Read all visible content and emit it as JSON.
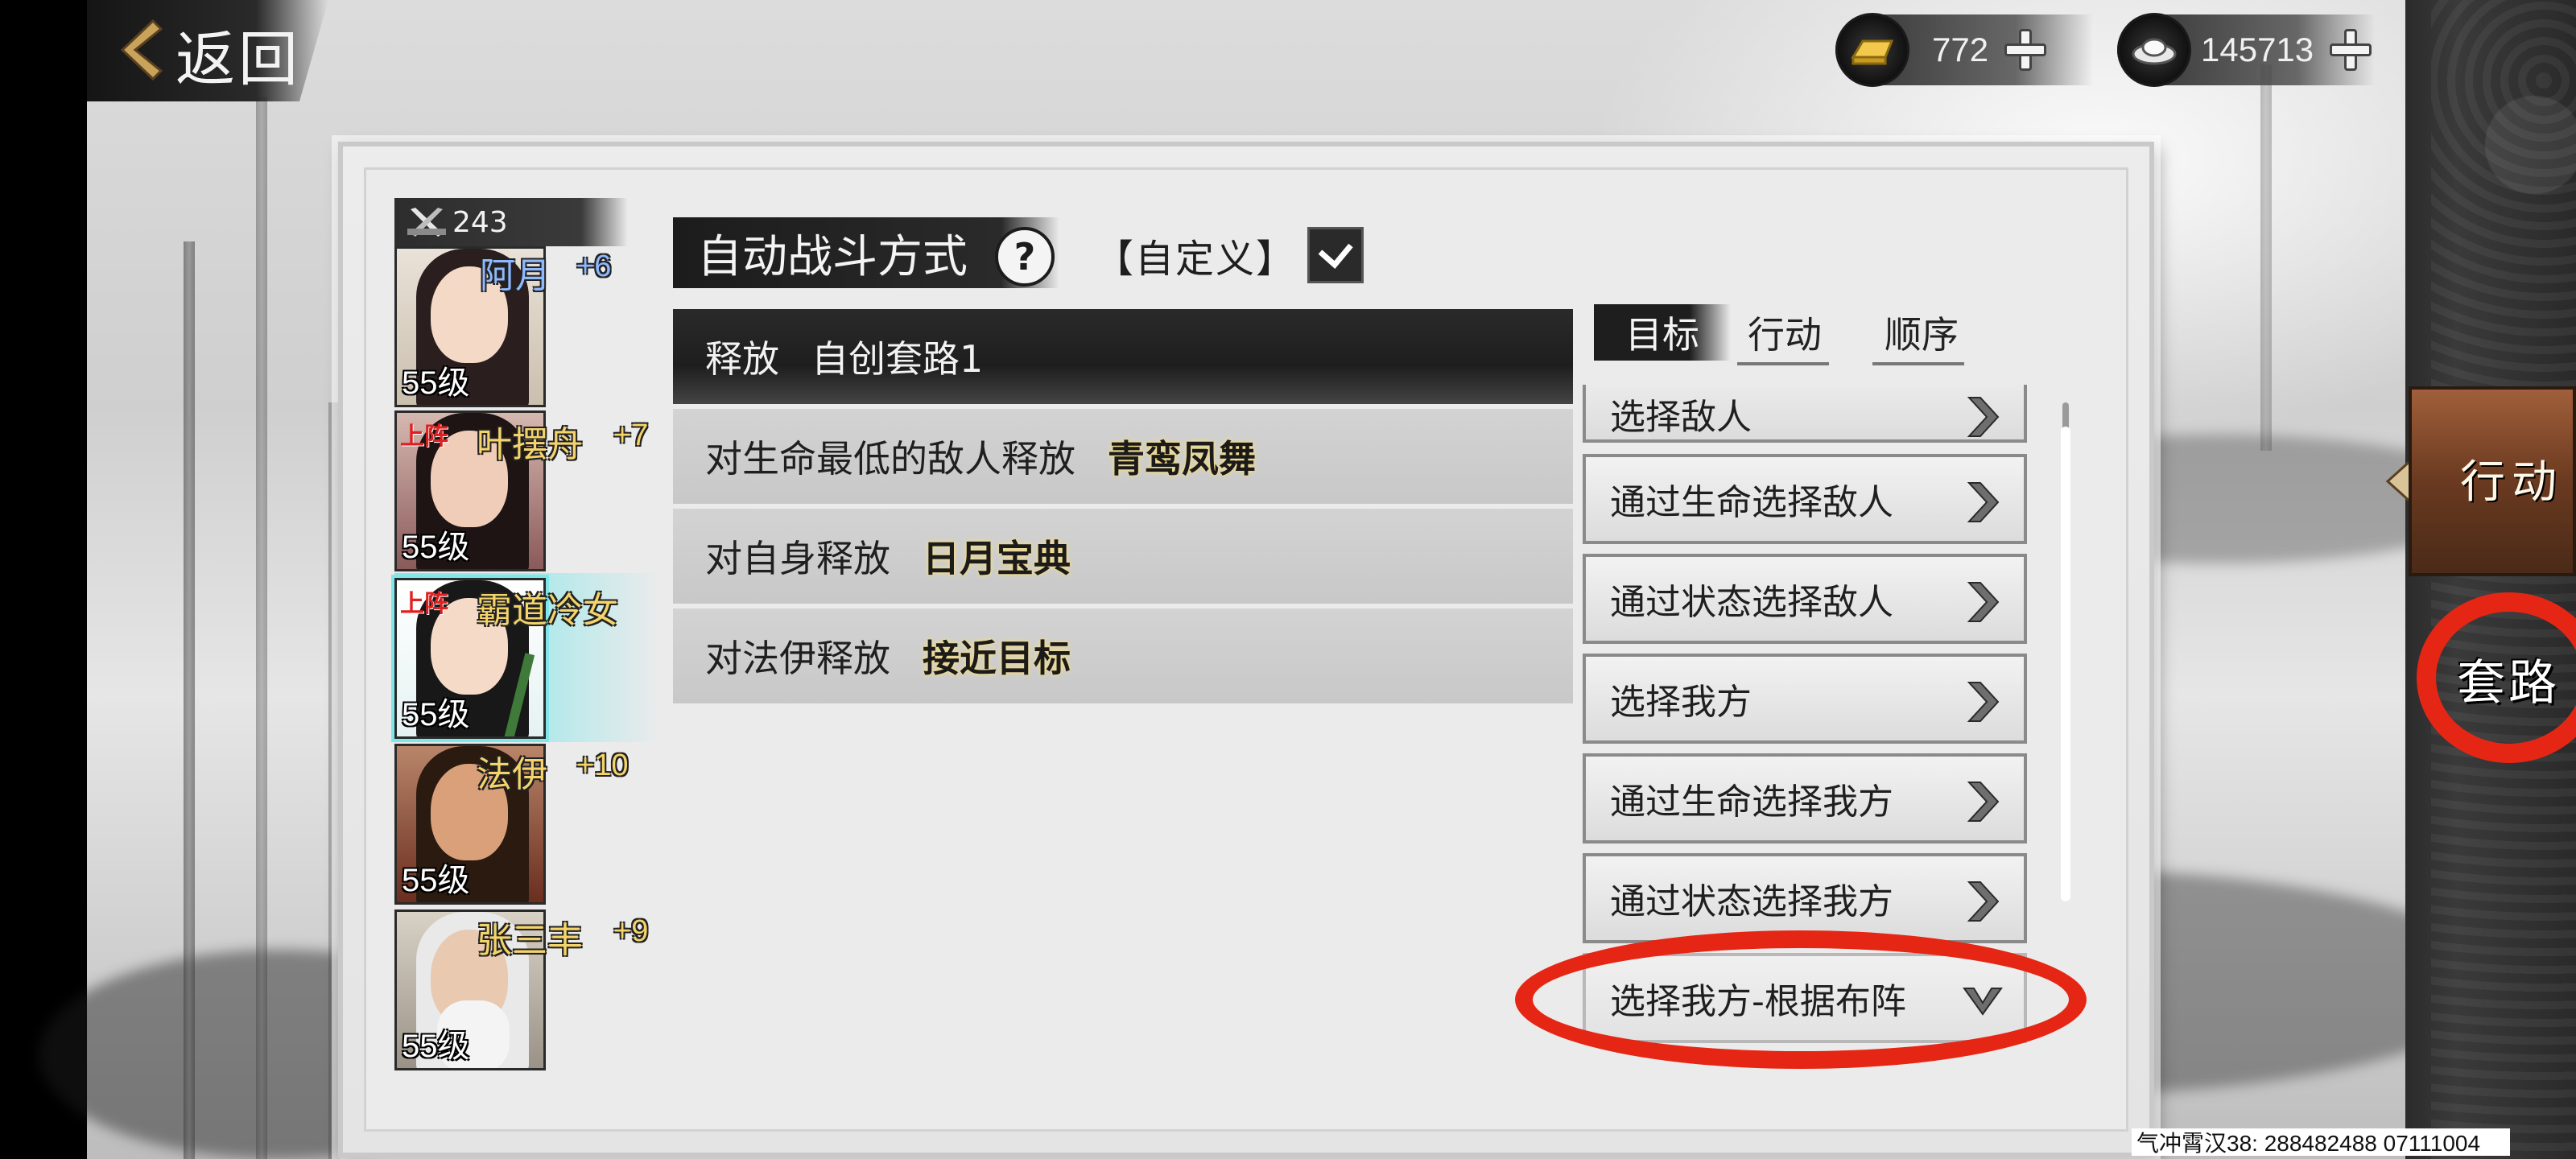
{
  "header": {
    "back_label": "返回",
    "gold": "772",
    "silver": "145713"
  },
  "roster": {
    "count": "243",
    "heroes": [
      {
        "name": "阿月",
        "bonus": "+6",
        "level": "55级",
        "tag": "",
        "name_color": "#8fb8ff",
        "bonus_color": "#8fb8ff"
      },
      {
        "name": "叶摆舟",
        "bonus": "+7",
        "level": "55级",
        "tag": "上阵",
        "name_color": "#f4d46a",
        "bonus_color": "#f4d46a"
      },
      {
        "name": "霸道冷女",
        "bonus": "",
        "level": "55级",
        "tag": "上阵",
        "name_color": "#f4d46a",
        "bonus_color": "#f4d46a"
      },
      {
        "name": "法伊",
        "bonus": "+10",
        "level": "55级",
        "tag": "",
        "name_color": "#f4d46a",
        "bonus_color": "#f4d46a"
      },
      {
        "name": "张三丰",
        "bonus": "+9",
        "level": "55级",
        "tag": "",
        "name_color": "#f4d46a",
        "bonus_color": "#f4d46a"
      }
    ]
  },
  "battle": {
    "title": "自动战斗方式",
    "help": "?",
    "mode": "【自定义】",
    "actions": [
      {
        "desc": "释放",
        "skill": "自创套路1"
      },
      {
        "desc": "对生命最低的敌人释放",
        "skill": "青鸾凤舞"
      },
      {
        "desc": "对自身释放",
        "skill": "日月宝典"
      },
      {
        "desc": "对法伊释放",
        "skill": "接近目标"
      }
    ]
  },
  "tabs": [
    "目标",
    "行动",
    "顺序"
  ],
  "targets": [
    "选择敌人",
    "通过生命选择敌人",
    "通过状态选择敌人",
    "选择我方",
    "通过生命选择我方",
    "通过状态选择我方",
    "选择我方-根据布阵"
  ],
  "side": {
    "action_btn": "行动",
    "routine_btn": "套路"
  },
  "watermark": "气冲霄汉38: 288482488  07111004",
  "colors": {
    "highlight_ring": "#e62614",
    "skill_glow": "#f4d46a",
    "selected_glow": "#7fe6ea"
  }
}
